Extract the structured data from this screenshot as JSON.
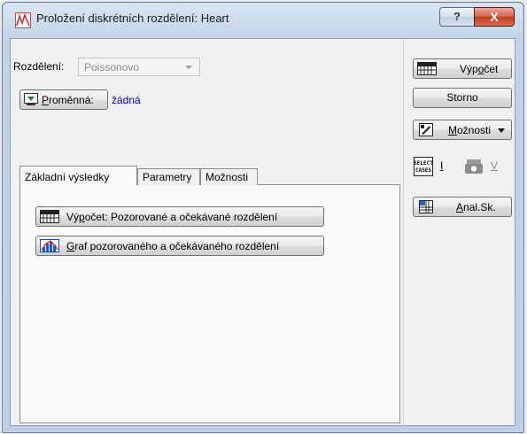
{
  "window": {
    "title": "Proložení diskrétních rozdělení: Heart",
    "help_label": "?",
    "close_label": "X"
  },
  "form": {
    "distribution_label": "Rozdělení:",
    "distribution_value": "Poissonovo",
    "variable_button_label_u": "P",
    "variable_button_label_rest": "roměnná:",
    "variable_value": "žádná"
  },
  "tabs": [
    {
      "label": "Základní výsledky",
      "active": true
    },
    {
      "label": "Parametry",
      "active": false
    },
    {
      "label": "Možnosti",
      "active": false
    }
  ],
  "panel": {
    "compute_label_pre": "Vý",
    "compute_label_u": "p",
    "compute_label_post": "očet:  Pozorované a očekávané rozdělení",
    "graph_label_u": "G",
    "graph_label_post": "raf pozorovaného a očekávaného rozdělení"
  },
  "side": {
    "compute_pre": "Výp",
    "compute_u": "o",
    "compute_post": "čet",
    "cancel": "Storno",
    "options_u": "M",
    "options_post": "ožnosti",
    "select_cases_icon_text": "SELECT\nCASES",
    "select_cases_key": "I",
    "weight_key": "V",
    "anal_u": "A",
    "anal_post": "nal.Sk."
  },
  "colors": {
    "link_blue": "#0000cc",
    "close_red": "#c03a22"
  }
}
